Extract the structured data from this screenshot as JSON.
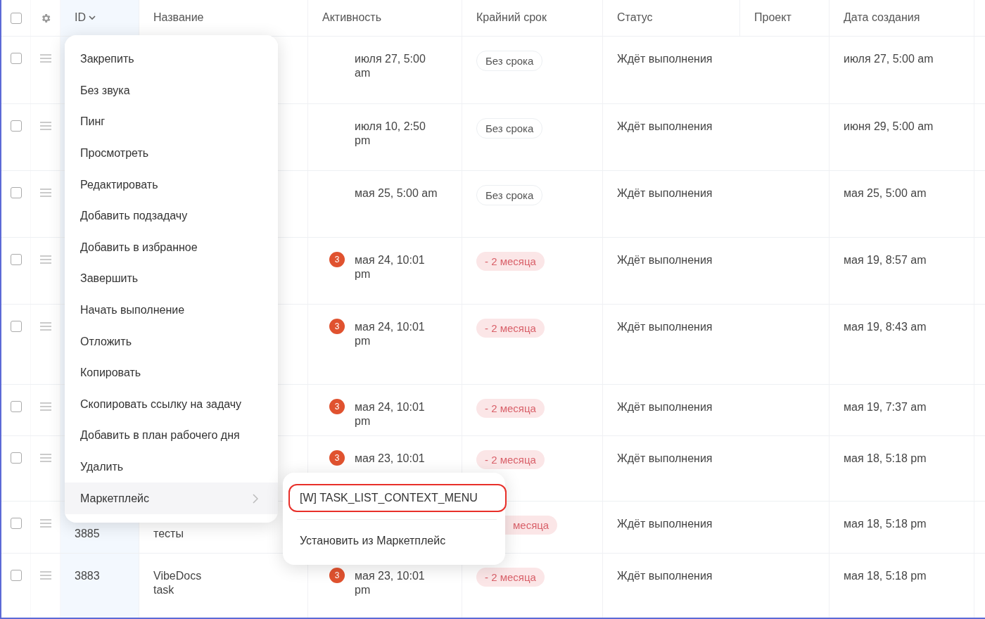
{
  "table": {
    "select_all": {
      "checked": false
    },
    "columns": [
      {
        "label": "ID",
        "sorted": true
      },
      {
        "label": "Название",
        "sorted": false
      },
      {
        "label": "Активность",
        "sorted": false
      },
      {
        "label": "Крайний срок",
        "sorted": false
      },
      {
        "label": "Статус",
        "sorted": false
      },
      {
        "label": "Проект",
        "sorted": false
      },
      {
        "label": "Дата создания",
        "sorted": false
      }
    ],
    "rows": [
      {
        "checked": false,
        "activity": "июля 27, 5:00 am",
        "deadline": {
          "kind": "none",
          "text": "Без срока"
        },
        "status": "Ждёт выполнения",
        "created": "июля 27, 5:00 am"
      },
      {
        "checked": false,
        "activity": "июля 10, 2:50 pm",
        "deadline": {
          "kind": "none",
          "text": "Без срока"
        },
        "status": "Ждёт выполнения",
        "created": "июня 29, 5:00 am"
      },
      {
        "checked": false,
        "activity": "мая 25, 5:00 am",
        "deadline": {
          "kind": "none",
          "text": "Без срока"
        },
        "status": "Ждёт выполнения",
        "created": "мая 25, 5:00 am"
      },
      {
        "checked": false,
        "badge": "3",
        "activity": "мая 24, 10:01 pm",
        "deadline": {
          "kind": "overdue",
          "text": "- 2 месяца"
        },
        "status": "Ждёт выполнения",
        "created": "мая 19, 8:57 am"
      },
      {
        "checked": false,
        "badge": "3",
        "activity": "мая 24, 10:01 pm",
        "deadline": {
          "kind": "overdue",
          "text": "- 2 месяца"
        },
        "status": "Ждёт выполнения",
        "created": "мая 19, 8:43 am"
      },
      {
        "checked": false,
        "badge": "3",
        "activity": "мая 24, 10:01 pm",
        "deadline": {
          "kind": "overdue",
          "text": "- 2 месяца"
        },
        "status": "Ждёт выполнения",
        "created": "мая 19, 7:37 am"
      },
      {
        "checked": false,
        "badge": "3",
        "activity": "мая 23, 10:01",
        "deadline": {
          "kind": "overdue",
          "text": "- 2 месяца"
        },
        "status": "Ждёт выполнения",
        "created": "мая 18, 5:18 pm"
      },
      {
        "checked": false,
        "id": "3885",
        "name": "тесты",
        "deadline": {
          "kind": "overdue",
          "text": "месяца"
        },
        "status": "Ждёт выполнения",
        "created": "мая 18, 5:18 pm"
      },
      {
        "checked": false,
        "id": "3883",
        "name": "VibeDocs task",
        "badge": "3",
        "activity": "мая 23, 10:01 pm",
        "deadline": {
          "kind": "overdue",
          "text": "- 2 месяца"
        },
        "status": "Ждёт выполнения",
        "created": "мая 18, 5:18 pm"
      }
    ]
  },
  "context_menu": {
    "items": [
      {
        "label": "Закрепить",
        "selected": false,
        "submenu": false
      },
      {
        "label": "Без звука",
        "selected": false,
        "submenu": false
      },
      {
        "label": "Пинг",
        "selected": false,
        "submenu": false
      },
      {
        "label": "Просмотреть",
        "selected": false,
        "submenu": false
      },
      {
        "label": "Редактировать",
        "selected": false,
        "submenu": false
      },
      {
        "label": "Добавить подзадачу",
        "selected": false,
        "submenu": false
      },
      {
        "label": "Добавить в избранное",
        "selected": false,
        "submenu": false
      },
      {
        "label": "Завершить",
        "selected": false,
        "submenu": false
      },
      {
        "label": "Начать выполнение",
        "selected": false,
        "submenu": false
      },
      {
        "label": "Отложить",
        "selected": false,
        "submenu": false
      },
      {
        "label": "Копировать",
        "selected": false,
        "submenu": false
      },
      {
        "label": "Скопировать ссылку на задачу",
        "selected": false,
        "submenu": false
      },
      {
        "label": "Добавить в план рабочего дня",
        "selected": false,
        "submenu": false
      },
      {
        "label": "Удалить",
        "selected": false,
        "submenu": false
      },
      {
        "label": "Маркетплейс",
        "selected": true,
        "submenu": true
      }
    ]
  },
  "submenu": {
    "items": [
      {
        "label": "[W] TASK_LIST_CONTEXT_MENU",
        "outlined": true
      },
      {
        "label": "Установить из Маркетплейс",
        "outlined": false
      }
    ]
  }
}
